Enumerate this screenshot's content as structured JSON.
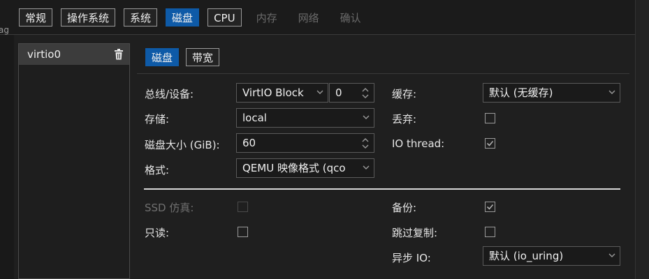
{
  "top_tabs": [
    {
      "label": "常规",
      "state": "normal"
    },
    {
      "label": "操作系统",
      "state": "normal"
    },
    {
      "label": "系统",
      "state": "normal"
    },
    {
      "label": "磁盘",
      "state": "active"
    },
    {
      "label": "CPU",
      "state": "normal"
    },
    {
      "label": "内存",
      "state": "disabled"
    },
    {
      "label": "网络",
      "state": "disabled"
    },
    {
      "label": "确认",
      "state": "disabled"
    }
  ],
  "left_edge_text": "ag",
  "disk_list": {
    "items": [
      {
        "label": "virtio0"
      }
    ]
  },
  "sub_tabs": [
    {
      "label": "磁盘",
      "state": "active"
    },
    {
      "label": "带宽",
      "state": "normal"
    }
  ],
  "form": {
    "bus_label": "总线/设备:",
    "bus_value": "VirtIO Block",
    "device_value": "0",
    "storage_label": "存储:",
    "storage_value": "local",
    "size_label": "磁盘大小 (GiB):",
    "size_value": "60",
    "format_label": "格式:",
    "format_value": "QEMU 映像格式 (qco",
    "cache_label": "缓存:",
    "cache_value": "默认 (无缓存)",
    "discard_label": "丢弃:",
    "discard_checked": false,
    "iothread_label": "IO thread:",
    "iothread_checked": true,
    "ssd_label": "SSD 仿真:",
    "ssd_checked": false,
    "readonly_label": "只读:",
    "readonly_checked": false,
    "backup_label": "备份:",
    "backup_checked": true,
    "skip_repl_label": "跳过复制:",
    "skip_repl_checked": false,
    "async_io_label": "异步 IO:",
    "async_io_value": "默认 (io_uring)"
  },
  "colors": {
    "accent": "#0e5aa7",
    "background": "#1c1c1c",
    "field_border": "#5a5a5a"
  }
}
